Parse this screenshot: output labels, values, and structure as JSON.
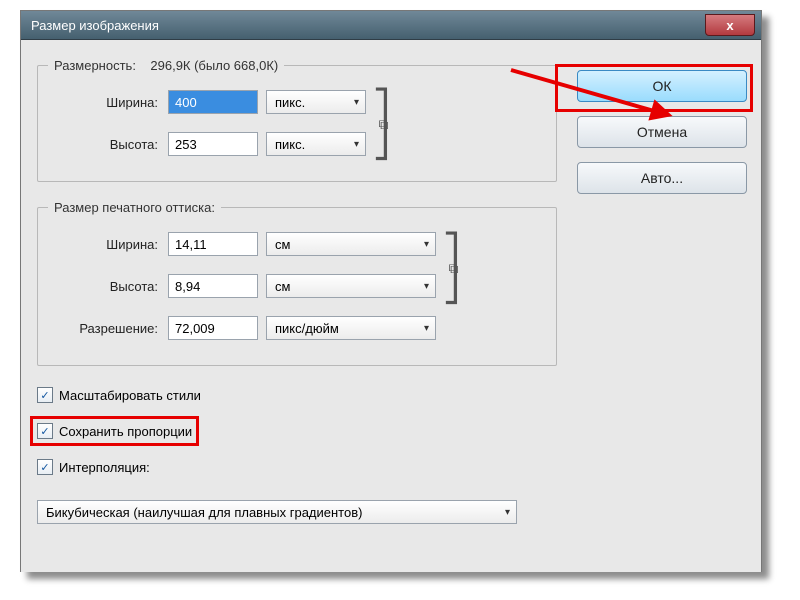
{
  "title": "Размер изображения",
  "close_glyph": "x",
  "buttons": {
    "ok": "ОК",
    "cancel": "Отмена",
    "auto": "Авто..."
  },
  "dims": {
    "legend": "Размерность:",
    "size_text": "296,9К (было 668,0К)",
    "width_label": "Ширина:",
    "width_value": "400",
    "height_label": "Высота:",
    "height_value": "253",
    "unit_px": "пикс."
  },
  "print": {
    "legend": "Размер печатного оттиска:",
    "width_label": "Ширина:",
    "width_value": "14,11",
    "height_label": "Высота:",
    "height_value": "8,94",
    "unit_cm": "см",
    "res_label": "Разрешение:",
    "res_value": "72,009",
    "res_unit": "пикс/дюйм"
  },
  "checks": {
    "scale_styles": "Масштабировать стили",
    "keep_aspect": "Сохранить пропорции",
    "interpolation": "Интерполяция:"
  },
  "interp_combo": "Бикубическая (наилучшая для плавных градиентов)",
  "icons": {
    "chevron": "▾",
    "check": "✓",
    "chain": "⧉"
  }
}
